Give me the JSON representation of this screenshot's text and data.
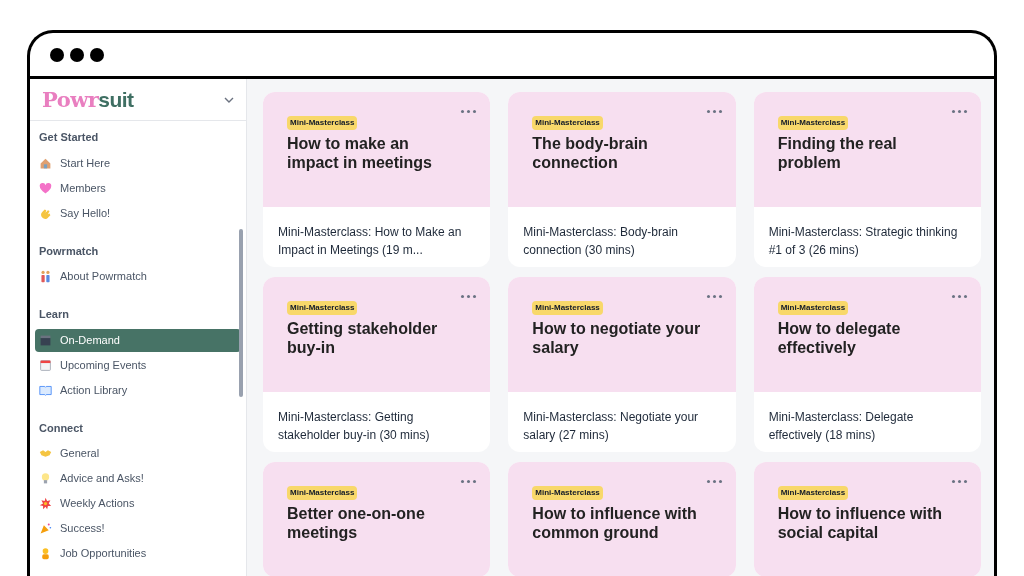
{
  "logo": {
    "part_1": "Powr",
    "part_2": "suit"
  },
  "sidebar": {
    "sections": [
      {
        "title": "Get Started",
        "items": [
          {
            "label": "Start Here",
            "selected": false
          },
          {
            "label": "Members",
            "selected": false
          },
          {
            "label": "Say Hello!",
            "selected": false
          }
        ]
      },
      {
        "title": "Powrmatch",
        "items": [
          {
            "label": "About Powrmatch",
            "selected": false
          }
        ]
      },
      {
        "title": "Learn",
        "items": [
          {
            "label": "On-Demand",
            "selected": true
          },
          {
            "label": "Upcoming Events",
            "selected": false
          },
          {
            "label": "Action Library",
            "selected": false
          }
        ]
      },
      {
        "title": "Connect",
        "items": [
          {
            "label": "General",
            "selected": false
          },
          {
            "label": "Advice and Asks!",
            "selected": false
          },
          {
            "label": "Weekly Actions",
            "selected": false
          },
          {
            "label": "Success!",
            "selected": false
          },
          {
            "label": "Job Opportunities",
            "selected": false
          }
        ]
      }
    ]
  },
  "cards": [
    {
      "tag": "Mini-Masterclass",
      "title": "How to make an impact in meetings",
      "description": "Mini-Masterclass: How to Make an Impact in Meetings (19 m..."
    },
    {
      "tag": "Mini-Masterclass",
      "title": "The body-brain connection",
      "description": "Mini-Masterclass: Body-brain connection (30 mins)"
    },
    {
      "tag": "Mini-Masterclass",
      "title": "Finding the real problem",
      "description": "Mini-Masterclass: Strategic thinking #1 of 3 (26 mins)"
    },
    {
      "tag": "Mini-Masterclass",
      "title": "Getting stakeholder buy-in",
      "description": "Mini-Masterclass: Getting stakeholder buy-in (30 mins)"
    },
    {
      "tag": "Mini-Masterclass",
      "title": "How to negotiate your salary",
      "description": "Mini-Masterclass: Negotiate your salary (27 mins)"
    },
    {
      "tag": "Mini-Masterclass",
      "title": "How to delegate effectively",
      "description": "Mini-Masterclass: Delegate effectively (18 mins)"
    },
    {
      "tag": "Mini-Masterclass",
      "title": "Better one-on-one meetings"
    },
    {
      "tag": "Mini-Masterclass",
      "title": "How to influence with common ground"
    },
    {
      "tag": "Mini-Masterclass",
      "title": "How to influence with social capital"
    }
  ]
}
